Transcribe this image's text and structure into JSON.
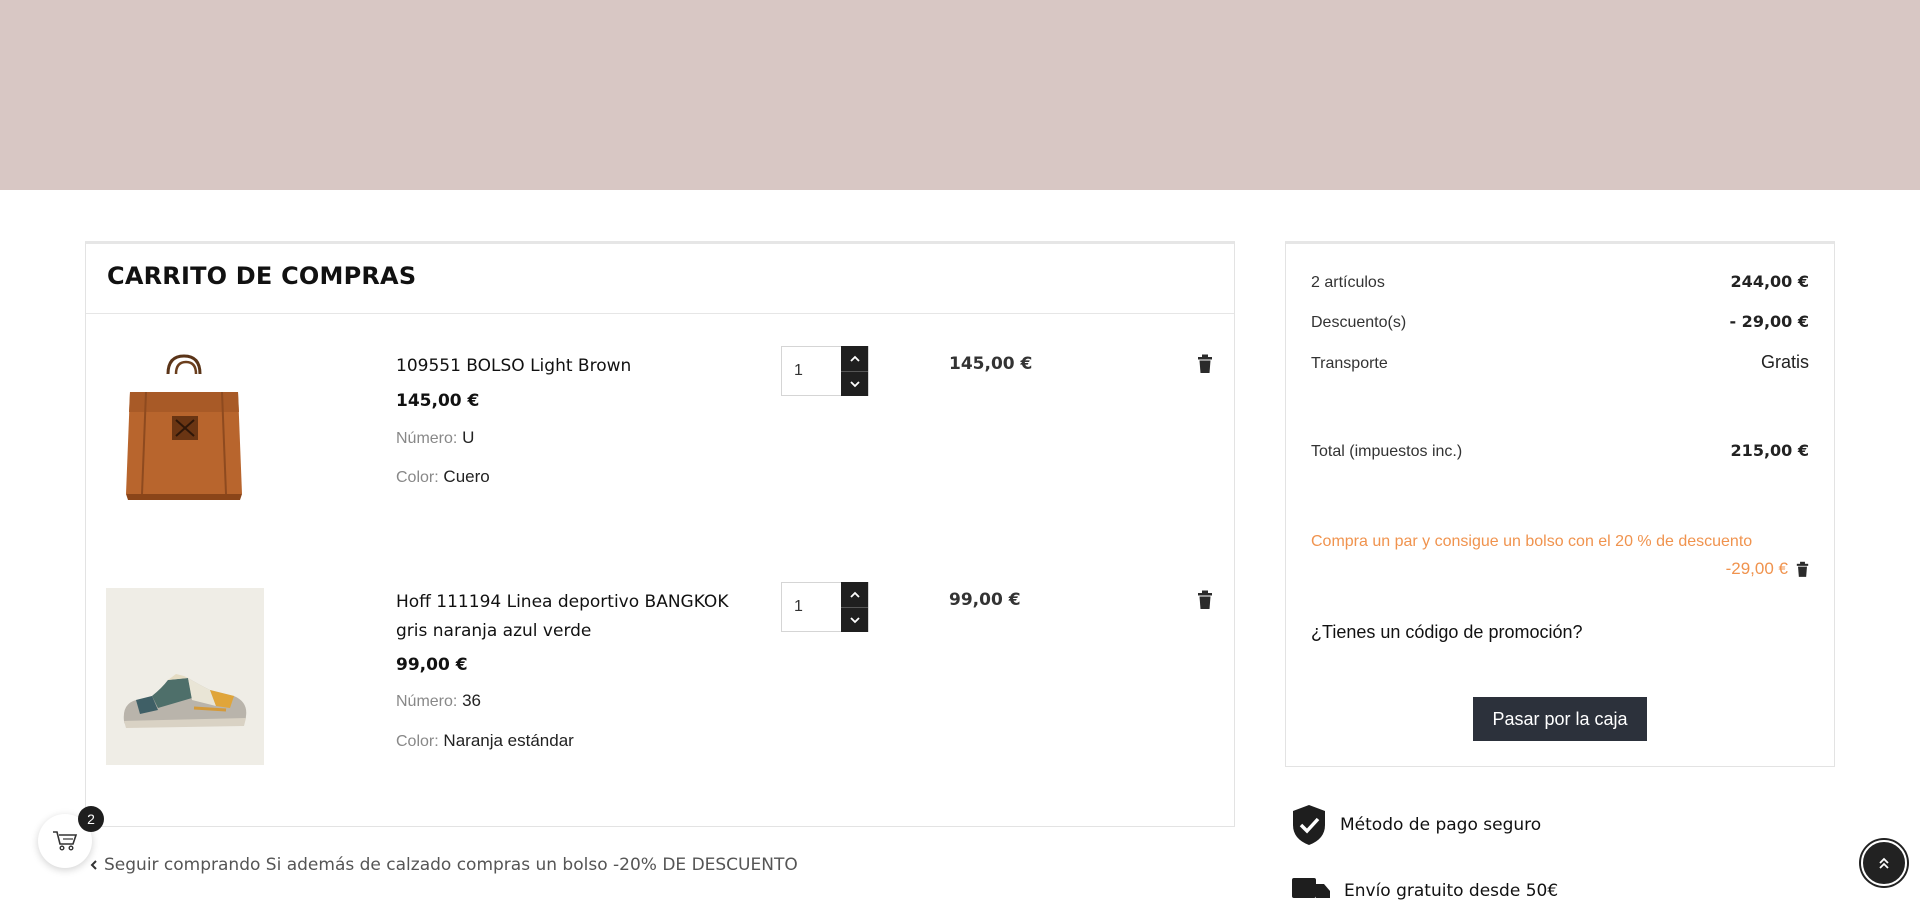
{
  "cart": {
    "title": "CARRITO DE COMPRAS",
    "items": [
      {
        "name": "109551 BOLSO Light Brown",
        "unit_price": "145,00 €",
        "size_label": "Número:",
        "size_value": "U",
        "color_label": "Color:",
        "color_value": "Cuero",
        "quantity": "1",
        "line_total": "145,00 €"
      },
      {
        "name": "Hoff 111194 Linea deportivo BANGKOK gris naranja azul verde",
        "unit_price": "99,00 €",
        "size_label": "Número:",
        "size_value": "36",
        "color_label": "Color:",
        "color_value": "Naranja estándar",
        "quantity": "1",
        "line_total": "99,00 €"
      }
    ]
  },
  "summary": {
    "items_label": "2 artículos",
    "items_value": "244,00 €",
    "discount_label": "Descuento(s)",
    "discount_value": "- 29,00 €",
    "shipping_label": "Transporte",
    "shipping_value": "Gratis",
    "total_label": "Total (impuestos inc.)",
    "total_value": "215,00 €",
    "promo_name": "Compra un par y consigue un bolso con el 20 % de descuento",
    "promo_amount": "-29,00 €",
    "promo_question": "¿Tienes un código de promoción?",
    "checkout_label": "Pasar por la caja"
  },
  "reassurance": {
    "secure_payment": "Método de pago seguro",
    "free_shipping": "Envío gratuito desde 50€"
  },
  "continue_shopping": "Seguir comprando Si además de calzado compras un bolso -20% DE DESCUENTO",
  "cart_badge_count": "2",
  "colors": {
    "hero": "#d8c7c4",
    "promo": "#f0934e",
    "checkout_button": "#2c313b",
    "spinner": "#1f1f1f"
  },
  "icons": [
    "trash-icon",
    "chevron-up-icon",
    "chevron-down-icon",
    "shield-check-icon",
    "truck-icon",
    "cart-icon",
    "chevron-left-icon",
    "double-chevron-up-icon"
  ]
}
